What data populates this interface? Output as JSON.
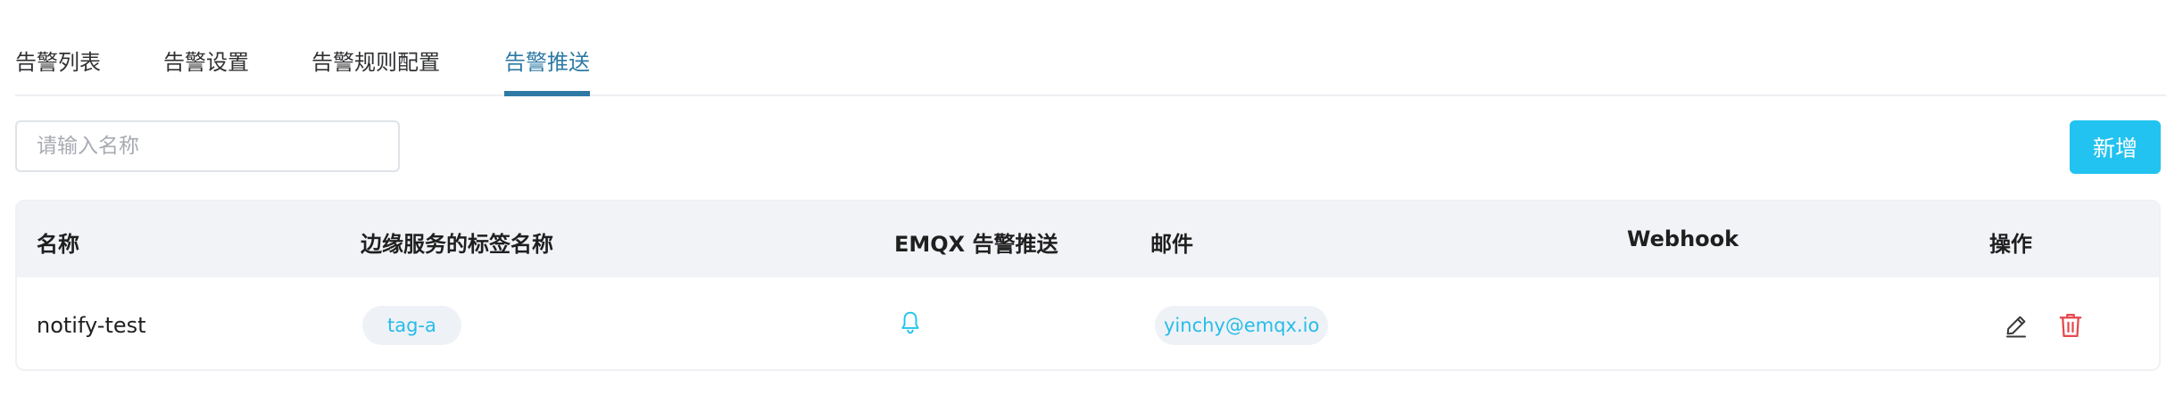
{
  "tabs": [
    {
      "label": "告警列表",
      "active": false
    },
    {
      "label": "告警设置",
      "active": false
    },
    {
      "label": "告警规则配置",
      "active": false
    },
    {
      "label": "告警推送",
      "active": true
    }
  ],
  "search": {
    "placeholder": "请输入名称",
    "value": ""
  },
  "toolbar": {
    "add_label": "新增"
  },
  "table": {
    "columns": [
      "名称",
      "边缘服务的标签名称",
      "EMQX 告警推送",
      "邮件",
      "Webhook",
      "操作"
    ],
    "rows": [
      {
        "name": "notify-test",
        "tag": "tag-a",
        "emqx_icon": "bell-icon",
        "email": "yinchy@emqx.io",
        "webhook": "",
        "actions": [
          "edit-icon",
          "delete-icon"
        ]
      }
    ]
  },
  "colors": {
    "accent": "#2e7aa5",
    "primary_button": "#22c3f0",
    "tag_text": "#27bde8",
    "danger": "#e5484d"
  }
}
